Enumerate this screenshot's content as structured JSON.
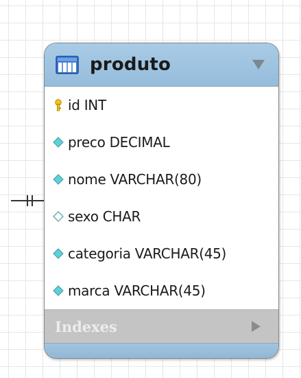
{
  "entity": {
    "name": "produto",
    "icon": "table-icon",
    "header_color": "#9ec3e0",
    "columns": [
      {
        "label": "id INT",
        "marker": "primary-key-icon"
      },
      {
        "label": "preco DECIMAL",
        "marker": "filled-diamond-icon"
      },
      {
        "label": "nome VARCHAR(80)",
        "marker": "filled-diamond-icon"
      },
      {
        "label": "sexo CHAR",
        "marker": "hollow-diamond-icon"
      },
      {
        "label": "categoria VARCHAR(45)",
        "marker": "filled-diamond-icon"
      },
      {
        "label": "marca VARCHAR(45)",
        "marker": "filled-diamond-icon"
      }
    ],
    "indexes_label": "Indexes"
  },
  "relationship": {
    "notation": "one-and-only-one"
  }
}
